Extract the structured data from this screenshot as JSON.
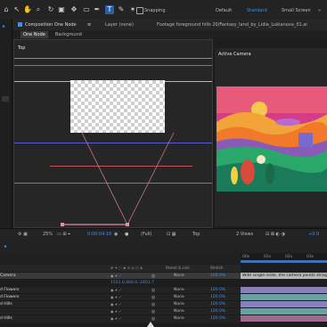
{
  "toolbar": {
    "tools": [
      "arrow",
      "hand",
      "zoom",
      "rotate",
      "camera",
      "pan",
      "rect",
      "pen",
      "type",
      "brush",
      "clone",
      "eraser",
      "roto",
      "puppet"
    ],
    "snapping_label": "Snapping",
    "workspaces": [
      {
        "label": "Default",
        "active": false
      },
      {
        "label": "Standard",
        "active": true
      },
      {
        "label": "Small Screen",
        "active": false
      }
    ]
  },
  "panel_tabs": {
    "composition": "Composition One Node",
    "layer": "Layer (none)",
    "footage": "Footage foreground hills 20/Fantasy_land_by_Lidia_Lukianova_01.ai"
  },
  "sub_tabs": {
    "active": "One Node",
    "other": "Background"
  },
  "viewer_left": {
    "label": "Top"
  },
  "viewer_right": {
    "label": "Active Camera"
  },
  "viewer_bar": {
    "zoom": "25%",
    "timecode": "0:00:04:16",
    "resolution": "(Full)",
    "view": "Top",
    "views": "2 Views",
    "exposure": "+0.0"
  },
  "timeline": {
    "ticks": [
      "00s",
      "01s",
      "02s",
      "03s"
    ],
    "column_labels": {
      "parent": "Parent & Link",
      "stretch": "Stretch"
    },
    "rows": [
      {
        "name": "Camera",
        "parent": "None",
        "stretch": "100.0%",
        "note": "With single node, the camera points straight at...",
        "color": "#c8c8c8",
        "selected": true
      },
      {
        "name": "",
        "value": "1551.0,480.0,-2401.7",
        "color": ""
      },
      {
        "name": "d Flowers",
        "parent": "None",
        "stretch": "100.0%",
        "color": "#8a7fb8"
      },
      {
        "name": "d Flowers",
        "parent": "None",
        "stretch": "100.0%",
        "color": "#6aa0a0"
      },
      {
        "name": "d Hills",
        "parent": "None",
        "stretch": "100.0%",
        "color": "#8a7fb8"
      },
      {
        "name": "",
        "parent": "None",
        "stretch": "100.0%",
        "color": "#6aa0a0"
      },
      {
        "name": "d Hills",
        "parent": "None",
        "stretch": "100.0%",
        "color": "#9c6a8a"
      }
    ]
  },
  "colors": {
    "accent": "#3f8eea",
    "panel": "#262626",
    "bg": "#1d1d1d"
  }
}
